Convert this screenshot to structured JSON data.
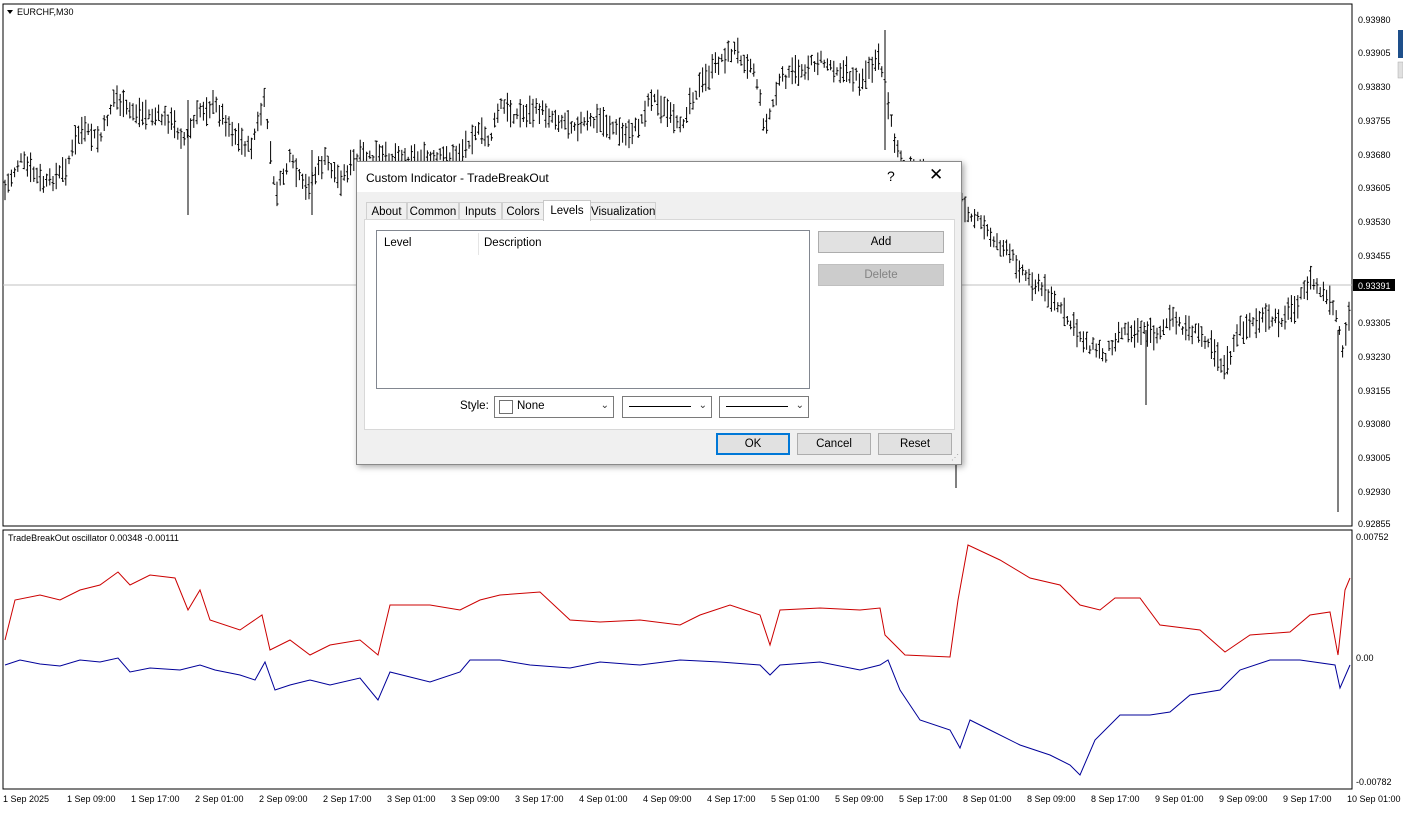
{
  "chart": {
    "symbol": "EURCHF,M30",
    "current_price": "0.93391",
    "price_ticks": [
      "0.93980",
      "0.93905",
      "0.93830",
      "0.93755",
      "0.93680",
      "0.93605",
      "0.93530",
      "0.93455",
      "0.93305",
      "0.93230",
      "0.93155",
      "0.93080",
      "0.93005",
      "0.92930",
      "0.92855"
    ],
    "indicator_label": "TradeBreakOut oscillator 0.00348 -0.00111",
    "indicator_ticks": [
      "0.00752",
      "0.00",
      "-0.00782"
    ],
    "time_labels": [
      "1 Sep 2025",
      "1 Sep 09:00",
      "1 Sep 17:00",
      "2 Sep 01:00",
      "2 Sep 09:00",
      "2 Sep 17:00",
      "3 Sep 01:00",
      "3 Sep 09:00",
      "3 Sep 17:00",
      "4 Sep 01:00",
      "4 Sep 09:00",
      "4 Sep 17:00",
      "5 Sep 01:00",
      "5 Sep 09:00",
      "5 Sep 17:00",
      "8 Sep 01:00",
      "8 Sep 09:00",
      "8 Sep 17:00",
      "9 Sep 01:00",
      "9 Sep 09:00",
      "9 Sep 17:00",
      "10 Sep 01:00"
    ],
    "colors": {
      "bars": "#000000",
      "oscillator_red": "#cc0000",
      "oscillator_blue": "#000099",
      "price_line": "#c0c0c0"
    }
  },
  "dialog": {
    "title": "Custom Indicator - TradeBreakOut",
    "help": "?",
    "close": "✕",
    "tabs": [
      "About",
      "Common",
      "Inputs",
      "Colors",
      "Levels",
      "Visualization"
    ],
    "active_tab": "Levels",
    "columns": [
      "Level",
      "Description"
    ],
    "add_label": "Add",
    "delete_label": "Delete",
    "style_label": "Style:",
    "color_value": "None",
    "ok_label": "OK",
    "cancel_label": "Cancel",
    "reset_label": "Reset"
  }
}
